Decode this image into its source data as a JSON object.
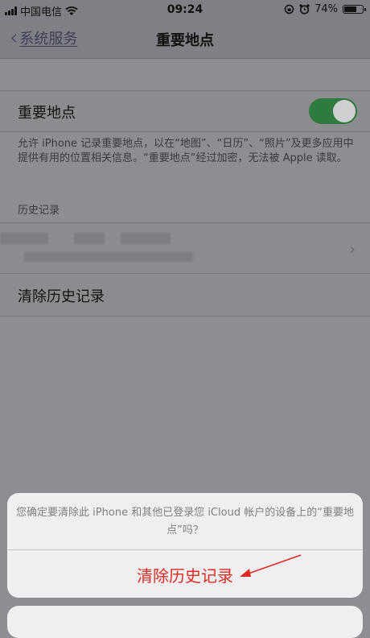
{
  "status_bar": {
    "carrier": "中国电信",
    "time": "09:24",
    "battery_percent_text": "74%",
    "battery_level": 0.74
  },
  "nav": {
    "back_label": "系统服务",
    "title": "重要地点"
  },
  "toggle_row": {
    "label": "重要地点",
    "enabled": true,
    "toggle_color": "#34c759"
  },
  "footer_text": "允许 iPhone 记录重要地点，以在“地图”、“日历”、“照片”及更多应用中提供有用的位置相关信息。“重要地点”经过加密，无法被 Apple 读取。",
  "history": {
    "section_header": "历史记录",
    "clear_label": "清除历史记录"
  },
  "action_sheet": {
    "message": "您确定要清除此 iPhone 和其他已登录您 iCloud 帐户的设备上的“重要地点”吗？",
    "destructive_label": "清除历史记录",
    "destructive_color": "#e02b22"
  }
}
